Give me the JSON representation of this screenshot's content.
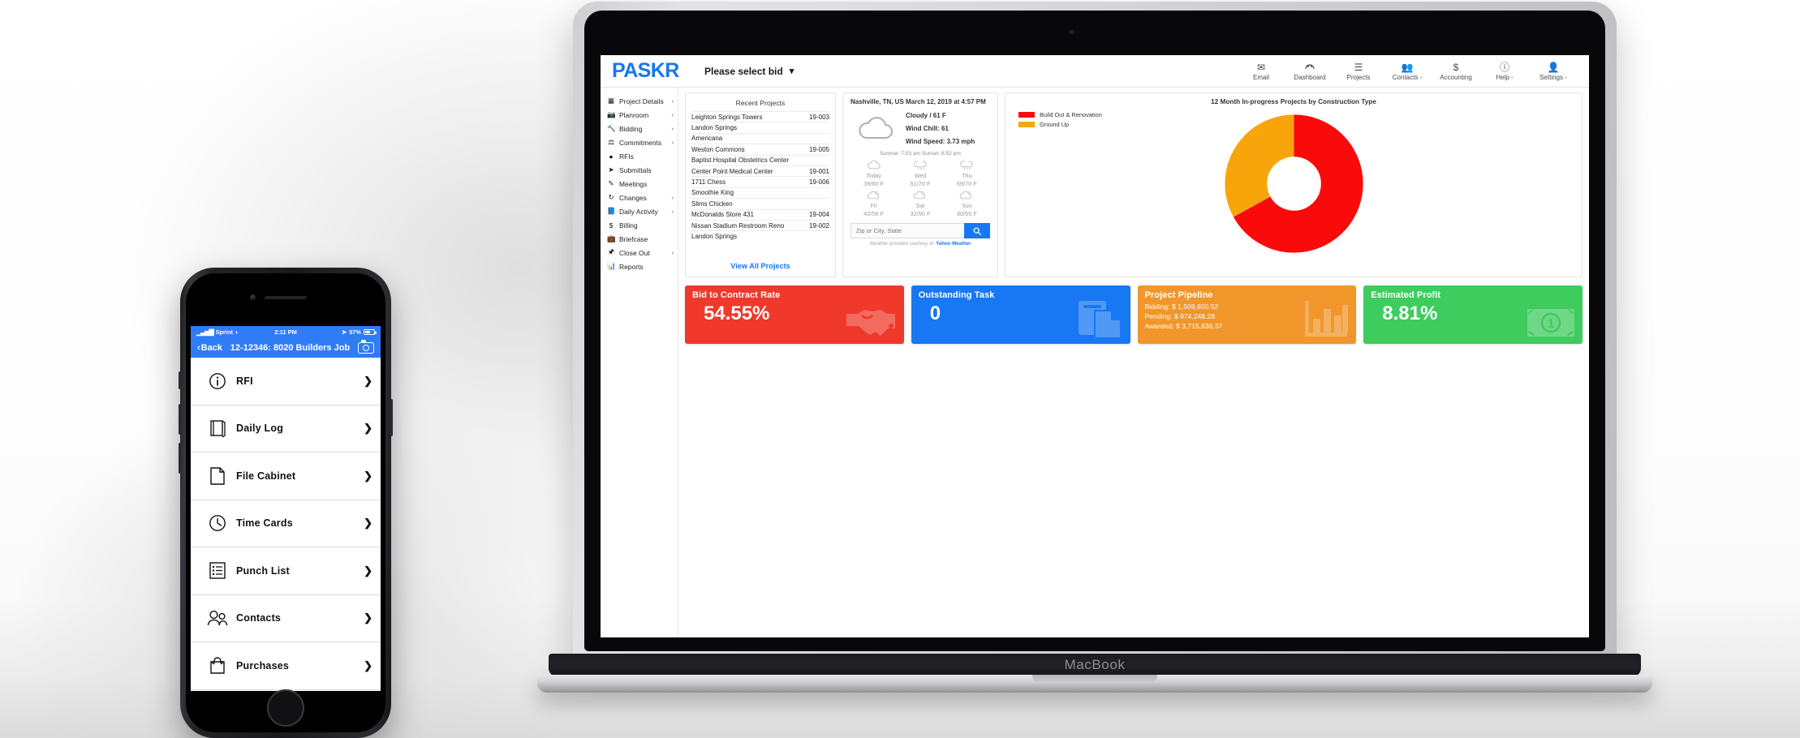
{
  "desktop": {
    "brand": "PASKR",
    "bid_selector": "Please select bid",
    "topnav": [
      {
        "label": "Email",
        "icon": "envelope-icon"
      },
      {
        "label": "Dashboard",
        "icon": "dashboard-icon"
      },
      {
        "label": "Projects",
        "icon": "list-icon"
      },
      {
        "label": "Contacts -",
        "icon": "people-icon"
      },
      {
        "label": "Accounting",
        "icon": "dollar-icon"
      },
      {
        "label": "Help -",
        "icon": "question-icon"
      },
      {
        "label": "Settings -",
        "icon": "person-icon"
      }
    ],
    "sidebar": [
      {
        "label": "Project Details",
        "icon": "tablet-icon",
        "arrow": "›"
      },
      {
        "label": "Planroom",
        "icon": "camera-icon",
        "arrow": "›"
      },
      {
        "label": "Bidding",
        "icon": "gavel-icon",
        "arrow": "›"
      },
      {
        "label": "Commitments",
        "icon": "scales-icon",
        "arrow": "›"
      },
      {
        "label": "RFIs",
        "icon": "info-icon",
        "arrow": ""
      },
      {
        "label": "Submittals",
        "icon": "paper-plane-icon",
        "arrow": ""
      },
      {
        "label": "Meetings",
        "icon": "edit-icon",
        "arrow": ""
      },
      {
        "label": "Changes",
        "icon": "refresh-icon",
        "arrow": "›"
      },
      {
        "label": "Daily Activity",
        "icon": "book-icon",
        "arrow": "›"
      },
      {
        "label": "Billing",
        "icon": "dollar-icon",
        "arrow": ""
      },
      {
        "label": "Briefcase",
        "icon": "briefcase-icon",
        "arrow": ""
      },
      {
        "label": "Close Out",
        "icon": "pin-icon",
        "arrow": "›"
      },
      {
        "label": "Reports",
        "icon": "bar-chart-icon",
        "arrow": ""
      }
    ],
    "recent_projects": {
      "title": "Recent Projects",
      "view_all": "View All Projects",
      "rows": [
        {
          "name": "Leighton Springs Towers",
          "number": "19-003"
        },
        {
          "name": "Landon Springs",
          "number": ""
        },
        {
          "name": "Americana",
          "number": ""
        },
        {
          "name": "Weston Commons",
          "number": "19-005"
        },
        {
          "name": "Baptist Hospital Obstetrics Center",
          "number": ""
        },
        {
          "name": "Center Point Medical Center",
          "number": "19-001"
        },
        {
          "name": "1711 Chess",
          "number": "19-006"
        },
        {
          "name": "Smoothie King",
          "number": ""
        },
        {
          "name": "Slims Chicken",
          "number": ""
        },
        {
          "name": "McDonalds Store 431",
          "number": "19-004"
        },
        {
          "name": "Nissan Stadium Restroom Reno",
          "number": "19-002"
        },
        {
          "name": "Landon Springs",
          "number": ""
        }
      ]
    },
    "weather": {
      "header": "Nashville, TN, US March 12, 2019 at 4:57 PM",
      "condition": "Cloudy / 61 F",
      "wind_chill": "Wind Chill: 61",
      "wind_speed": "Wind Speed: 3.73 mph",
      "sun": "Sunrise: 7:03 am  Sunset: 6:52 pm",
      "forecast": [
        {
          "day": "Today",
          "temp": "39/60 F",
          "icon": "cloud-icon"
        },
        {
          "day": "Wed",
          "temp": "51/70 F",
          "icon": "rain-icon"
        },
        {
          "day": "Thu",
          "temp": "59/70 F",
          "icon": "rain-icon"
        },
        {
          "day": "Fri",
          "temp": "42/56 F",
          "icon": "partly-sunny-icon"
        },
        {
          "day": "Sat",
          "temp": "32/50 F",
          "icon": "partly-sunny-icon"
        },
        {
          "day": "Sun",
          "temp": "30/55 F",
          "icon": "partly-sunny-icon"
        }
      ],
      "search_placeholder": "Zip or City, State",
      "search_value": "",
      "search_icon": "search-icon",
      "credit_prefix": "Weather provided courtesy of: ",
      "credit_link": "Yahoo Weather"
    },
    "kpis": [
      {
        "title": "Bid to Contract Rate",
        "value": "54.55%",
        "color": "#f0392b",
        "art": "handshake-icon"
      },
      {
        "title": "Outstanding Task",
        "value": "0",
        "color": "#1877f2",
        "art": "documents-icon"
      },
      {
        "title": "Project Pipeline",
        "color": "#f0962a",
        "art": "bar-chart-icon",
        "lines": [
          "Bidding: $ 1,509,650.52",
          "Pending: $ 974,248.28",
          "Awarded: $ 3,715,636.37"
        ]
      },
      {
        "title": "Estimated Profit",
        "value": "8.81%",
        "color": "#3ecc5f",
        "art": "money-icon"
      }
    ],
    "chart_data": {
      "type": "pie",
      "title": "12 Month In-progress Projects by Construction Type",
      "labels": [
        "Build Out & Renovation",
        "Ground Up"
      ],
      "values": [
        67,
        33
      ],
      "colors": [
        "#fa0a0a",
        "#f7a50a"
      ],
      "legend_position": "top-left",
      "donut": true,
      "inner_radius_ratio": 0.55
    }
  },
  "phone": {
    "status": {
      "carrier": "Sprint",
      "time": "2:11 PM",
      "battery": "57%"
    },
    "nav": {
      "back": "Back",
      "title": "12-12346: 8020 Builders Job",
      "camera_icon": "camera-icon"
    },
    "items": [
      {
        "label": "RFI",
        "icon": "info-circle-icon"
      },
      {
        "label": "Daily Log",
        "icon": "notebook-icon"
      },
      {
        "label": "File Cabinet",
        "icon": "document-icon"
      },
      {
        "label": "Time Cards",
        "icon": "clock-icon"
      },
      {
        "label": "Punch List",
        "icon": "checklist-icon"
      },
      {
        "label": "Contacts",
        "icon": "people-icon"
      },
      {
        "label": "Purchases",
        "icon": "shopping-bag-icon"
      }
    ]
  },
  "hardware": {
    "laptop_label": "MacBook"
  }
}
